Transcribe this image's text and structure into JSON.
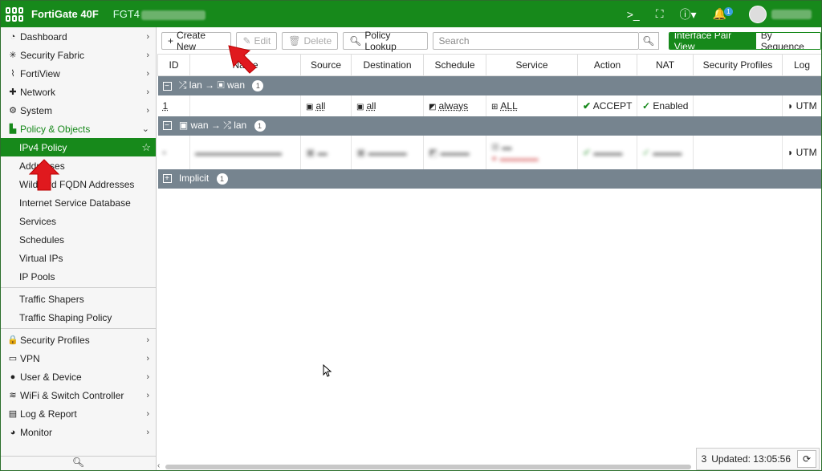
{
  "topbar": {
    "brand": "FortiGate 40F",
    "serial_prefix": "FGT4",
    "icons": [
      "cli-console-icon",
      "fullscreen-icon",
      "help-icon",
      "bell-icon",
      "avatar"
    ],
    "notification_count": "1"
  },
  "sidebar": {
    "items": [
      {
        "label": "Dashboard",
        "icon": "dashboard-icon"
      },
      {
        "label": "Security Fabric",
        "icon": "fabric-icon"
      },
      {
        "label": "FortiView",
        "icon": "chart-icon"
      },
      {
        "label": "Network",
        "icon": "network-icon"
      },
      {
        "label": "System",
        "icon": "gear-icon"
      },
      {
        "label": "Policy & Objects",
        "icon": "policy-icon"
      }
    ],
    "sub_items": [
      "IPv4 Policy",
      "Addresses",
      "Wildcard FQDN Addresses",
      "Internet Service Database",
      "Services",
      "Schedules",
      "Virtual IPs",
      "IP Pools",
      "Traffic Shapers",
      "Traffic Shaping Policy"
    ],
    "items_after": [
      {
        "label": "Security Profiles",
        "icon": "lock-icon"
      },
      {
        "label": "VPN",
        "icon": "laptop-icon"
      },
      {
        "label": "User & Device",
        "icon": "user-icon"
      },
      {
        "label": "WiFi & Switch Controller",
        "icon": "wifi-icon"
      },
      {
        "label": "Log & Report",
        "icon": "report-icon"
      },
      {
        "label": "Monitor",
        "icon": "monitor-icon"
      }
    ]
  },
  "toolbar": {
    "create_new": "Create New",
    "edit": "Edit",
    "delete": "Delete",
    "policy_lookup": "Policy Lookup",
    "search_placeholder": "Search",
    "view_interface_pair": "Interface Pair View",
    "view_by_sequence": "By Sequence"
  },
  "table": {
    "columns": [
      "ID",
      "Name",
      "Source",
      "Destination",
      "Schedule",
      "Service",
      "Action",
      "NAT",
      "Security Profiles",
      "Log"
    ],
    "groups": [
      {
        "label_from": "lan",
        "label_to": "wan",
        "count": "1"
      },
      {
        "label_from": "wan",
        "label_to": "lan",
        "count": "1"
      },
      {
        "label": "Implicit",
        "count": "1"
      }
    ],
    "row1": {
      "id": "1",
      "name": "",
      "source": "all",
      "destination": "all",
      "schedule": "always",
      "service": "ALL",
      "action": "ACCEPT",
      "nat": "Enabled",
      "security_profiles": "",
      "log": "UTM"
    },
    "row2": {
      "log": "UTM"
    }
  },
  "status": {
    "count": "3",
    "updated": "Updated: 13:05:56"
  }
}
